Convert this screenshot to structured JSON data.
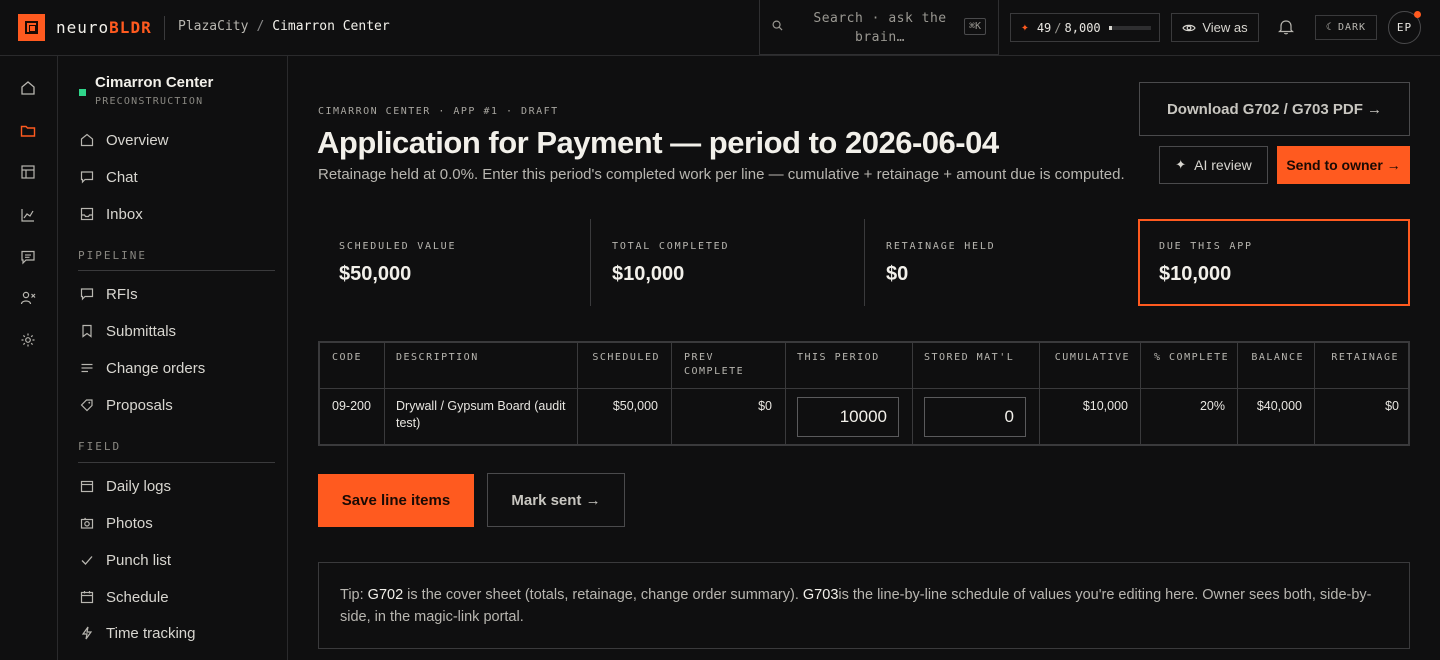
{
  "topbar": {
    "brand_a": "neuro",
    "brand_b": "BLDR",
    "breadcrumb_org": "PlazaCity",
    "breadcrumb_sep": "/",
    "breadcrumb_project": "Cimarron Center",
    "search_placeholder": "Search · ask the brain…",
    "search_shortcut": "⌘K",
    "credits_used": "49",
    "credits_sep": "/",
    "credits_total": "8,000",
    "credits_fraction": 0.006,
    "view_as_label": "View as",
    "theme_label": "DARK",
    "avatar_initials": "EP"
  },
  "sidebar": {
    "project_name": "Cimarron Center",
    "project_phase": "PRECONSTRUCTION",
    "top_items": [
      "Overview",
      "Chat",
      "Inbox"
    ],
    "pipeline_title": "PIPELINE",
    "pipeline_items": [
      "RFIs",
      "Submittals",
      "Change orders",
      "Proposals"
    ],
    "field_title": "FIELD",
    "field_items": [
      "Daily logs",
      "Photos",
      "Punch list",
      "Schedule",
      "Time tracking"
    ]
  },
  "page": {
    "eyebrow": "CIMARRON CENTER · APP #1 · DRAFT",
    "title": "Application for Payment — period to 2026-06-04",
    "subtitle": "Retainage held at 0.0%. Enter this period's completed work per line — cumulative + retainage + amount due is computed.",
    "download_label": "Download G702 / G703 PDF →",
    "ai_review_label": "AI review",
    "send_owner_label": "Send to owner →"
  },
  "stats": [
    {
      "label": "SCHEDULED VALUE",
      "value": "$50,000"
    },
    {
      "label": "TOTAL COMPLETED",
      "value": "$10,000"
    },
    {
      "label": "RETAINAGE HELD",
      "value": "$0"
    },
    {
      "label": "DUE THIS APP",
      "value": "$10,000"
    }
  ],
  "table": {
    "headers": [
      "CODE",
      "DESCRIPTION",
      "SCHEDULED",
      "PREV COMPLETE",
      "THIS PERIOD",
      "STORED MAT'L",
      "CUMULATIVE",
      "% COMPLETE",
      "BALANCE",
      "RETAINAGE"
    ],
    "row": {
      "code": "09-200",
      "description": "Drywall / Gypsum Board (audit test)",
      "scheduled": "$50,000",
      "prev_complete": "$0",
      "this_period": "10000",
      "stored": "0",
      "cumulative": "$10,000",
      "pct_complete": "20%",
      "balance": "$40,000",
      "retainage": "$0"
    }
  },
  "actions": {
    "save_label": "Save line items",
    "mark_sent_label": "Mark sent →"
  },
  "tip": {
    "prefix": "Tip: ",
    "g702": "G702",
    "g702_desc": " is the cover sheet (totals, retainage, change order summary). ",
    "g703": "G703",
    "g703_desc": "is the line-by-line schedule of values you're editing here. Owner sees both, side-by-side, in the magic-link portal."
  },
  "colors": {
    "accent": "#ff5a1f",
    "status": "#2fd58a",
    "background": "#0f0f10"
  },
  "icons": [
    "search-icon",
    "eye-icon",
    "bell-icon",
    "moon-icon",
    "home-icon",
    "folder-icon",
    "table-icon",
    "chart-icon",
    "message-icon",
    "user-x-icon",
    "settings-icon"
  ]
}
